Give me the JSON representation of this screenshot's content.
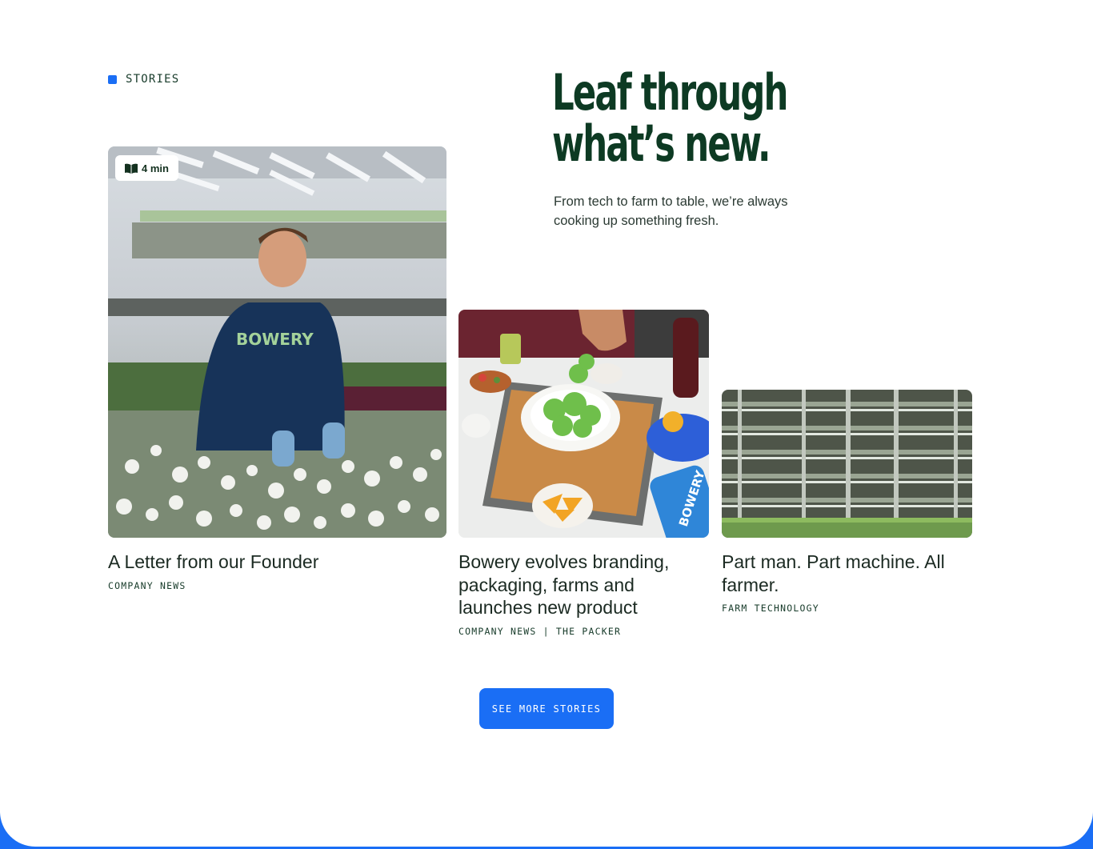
{
  "section": {
    "eyebrow": "STORIES",
    "headline_line1": "Leaf through",
    "headline_line2": "what’s new.",
    "subtitle": "From tech to farm to table, we’re always cooking up something fresh."
  },
  "cards": [
    {
      "title": "A Letter from our Founder",
      "tag": "COMPANY NEWS",
      "read_time": "4 min",
      "read_icon": "book-open-icon",
      "image_alt": "Farmer in BOWERY shirt tending white flowers",
      "shirt_text": "BOWERY"
    },
    {
      "title": "Bowery evolves branding, packaging, farms and launches new product",
      "tag": "COMPANY NEWS | THE PACKER",
      "image_alt": "Salad being prepared on cutting board with Bowery package",
      "package_text": "BOWERY"
    },
    {
      "title": "Part man. Part machine. All farmer.",
      "tag": "FARM TECHNOLOGY",
      "image_alt": "Vertical farm shelving racks"
    }
  ],
  "cta": {
    "label": "SEE MORE STORIES"
  },
  "colors": {
    "accent": "#1a6ef5",
    "headline": "#0d3a23",
    "text": "#1b2a22"
  }
}
